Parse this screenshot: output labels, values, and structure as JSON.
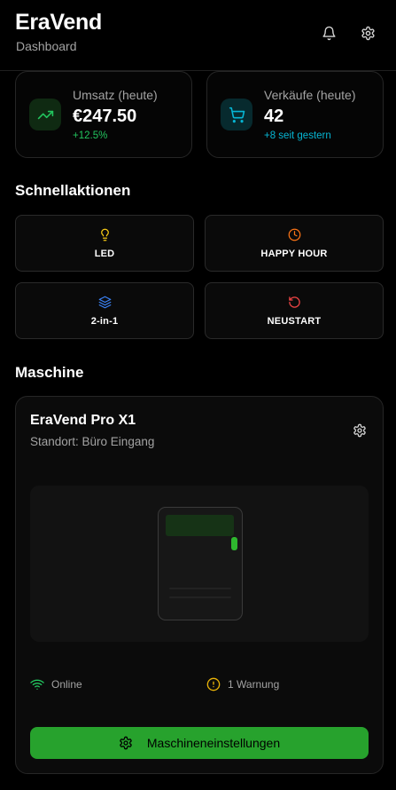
{
  "header": {
    "title": "EraVend",
    "subtitle": "Dashboard",
    "icons": [
      "bell-icon",
      "gear-icon"
    ]
  },
  "stats": [
    {
      "label": "Umsatz (heute)",
      "value": "€247.50",
      "delta": "+12.5%",
      "icon": "trending-up-icon",
      "accent": "#22c55e"
    },
    {
      "label": "Verkäufe (heute)",
      "value": "42",
      "delta": "+8 seit gestern",
      "icon": "cart-icon",
      "accent": "#06b6d4"
    }
  ],
  "quick_actions": {
    "title": "Schnellaktionen",
    "items": [
      {
        "label": "LED",
        "icon": "lightbulb-icon",
        "color": "#facc15"
      },
      {
        "label": "HAPPY HOUR",
        "icon": "clock-icon",
        "color": "#f97316"
      },
      {
        "label": "2-in-1",
        "icon": "layers-icon",
        "color": "#3b82f6"
      },
      {
        "label": "NEUSTART",
        "icon": "rotate-icon",
        "color": "#ef4444"
      }
    ]
  },
  "machine": {
    "section_title": "Maschine",
    "name": "EraVend Pro X1",
    "location": "Standort: Büro Eingang",
    "status_online": "Online",
    "status_warning": "1 Warnung",
    "settings_button": "Maschineneinstellungen",
    "colors": {
      "online": "#22c55e",
      "warning": "#eab308",
      "button": "#27a22d"
    }
  }
}
